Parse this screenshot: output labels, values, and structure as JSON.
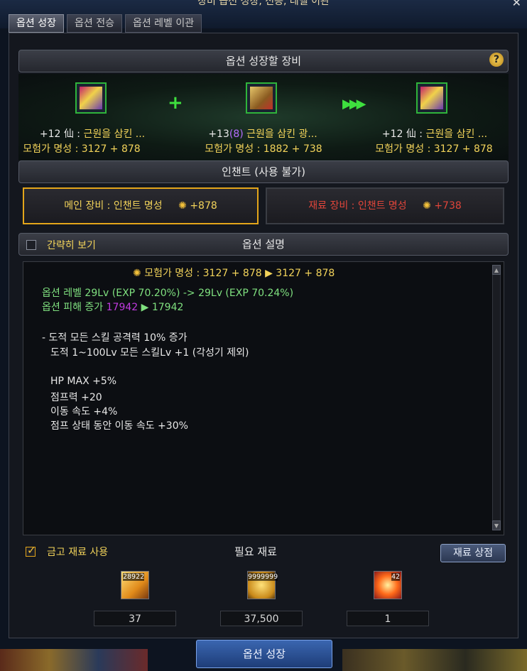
{
  "window": {
    "title": "장비 옵션 성장, 전승, 레벨 이관"
  },
  "tabs": [
    "옵션 성장",
    "옵션 전승",
    "옵션 레벨 이관"
  ],
  "equip_header": "옵션 성장할 장비",
  "help": "?",
  "items": [
    {
      "name_prefix": "+12 仙 : ",
      "name": "근원을 삼킨 ...",
      "fame": "모험가 명성 : 3127 + 878"
    },
    {
      "name_prefix": "+13",
      "name_extra": "(8)",
      "name": " 근원을 삼킨 광...",
      "fame": "모험가 명성 : 1882 + 738"
    },
    {
      "name_prefix": "+12 仙 : ",
      "name": "근원을 삼킨 ...",
      "fame": "모험가 명성 : 3127 + 878"
    }
  ],
  "enchant_header": "인챈트 (사용 불가)",
  "main_enchant": {
    "label": "메인 장비 : 인챈트 명성",
    "value": "+878"
  },
  "mat_enchant": {
    "label": "재료 장비 : 인챈트 명성",
    "value": "+738"
  },
  "simple_view": "간략히 보기",
  "desc_header": "옵션 설명",
  "desc": {
    "fame_line": "모험가 명성 : 3127 + 878 ▶ 3127 + 878",
    "level_line": "옵션 레벨 29Lv (EXP 70.20%) -> 29Lv (EXP 70.24%)",
    "dmg_label": "옵션 피해 증가 ",
    "dmg_from": "17942",
    "dmg_to": " ▶ 17942",
    "skill1": "- 도적 모든 스킬 공격력 10% 증가",
    "skill2": "도적 1~100Lv 모든 스킬Lv +1 (각성기 제외)",
    "stat1": "HP MAX +5%",
    "stat2": "점프력 +20",
    "stat3": "이동 속도 +4%",
    "stat4": "점프 상태 동안 이동 속도 +30%"
  },
  "safe_materials": "금고 재료 사용",
  "required_header": "필요 재료",
  "material_shop": "재료 상점",
  "materials": [
    {
      "count": "28922",
      "qty": "37"
    },
    {
      "count": "9999999",
      "qty": "37,500"
    },
    {
      "count": "42",
      "qty": "1"
    }
  ],
  "grow_button": "옵션 성장",
  "colors": {
    "accent": "#f2d35a",
    "green": "#3ee03e",
    "red": "#e0453a",
    "purple": "#c03adf"
  }
}
